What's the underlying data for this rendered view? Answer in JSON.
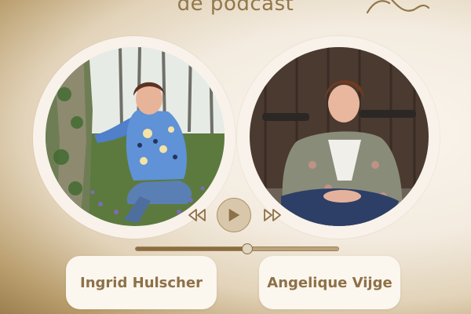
{
  "header": {
    "title": "de podcast"
  },
  "logo": {
    "icon": "script-letter-logo"
  },
  "guests": [
    {
      "name": "Ingrid Hulscher",
      "photo": "woman-crouching-in-forest-photo"
    },
    {
      "name": "Angelique Vijge",
      "photo": "woman-sitting-by-wooden-door-photo"
    }
  ],
  "player": {
    "prev_icon": "rewind-icon",
    "play_icon": "play-icon",
    "next_icon": "fast-forward-icon",
    "progress_fraction": 0.55
  },
  "colors": {
    "accent": "#8d7148",
    "card_background": "#fbf6ee",
    "gold_gradient_edge": "#9c7f4e"
  }
}
